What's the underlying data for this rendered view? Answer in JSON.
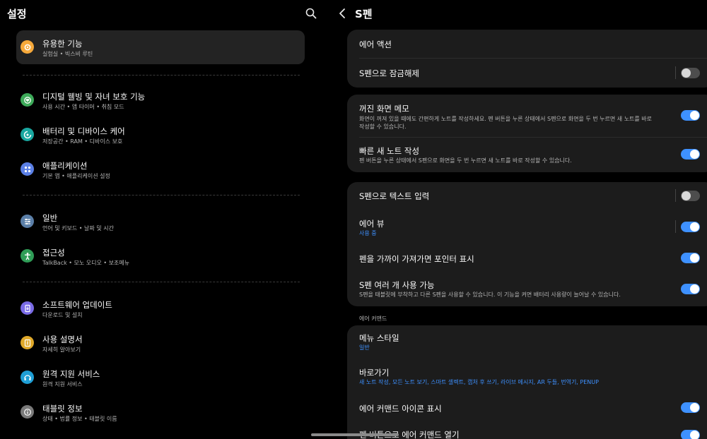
{
  "left": {
    "title": "설정",
    "items": [
      {
        "title": "유용한 기능",
        "subtitle": "실험실 • 빅스비 루틴",
        "icon": "gear-star-icon",
        "color": "#f6a93b"
      },
      {
        "title": "디지털 웰빙 및 자녀 보호 기능",
        "subtitle": "사용 시간 • 앱 타이머 • 취침 모드",
        "icon": "heart-icon",
        "color": "#3daa59"
      },
      {
        "title": "배터리 및 디바이스 케어",
        "subtitle": "저장공간 • RAM • 디바이스 보호",
        "icon": "device-care-icon",
        "color": "#19a7a0"
      },
      {
        "title": "애플리케이션",
        "subtitle": "기본 앱 • 애플리케이션 설정",
        "icon": "apps-icon",
        "color": "#5b80e6"
      },
      {
        "title": "일반",
        "subtitle": "언어 및 키보드 • 날짜 및 시간",
        "icon": "sliders-icon",
        "color": "#5b7fa8"
      },
      {
        "title": "접근성",
        "subtitle": "TalkBack • 모노 오디오 • 보조메뉴",
        "icon": "accessibility-icon",
        "color": "#2f9d57"
      },
      {
        "title": "소프트웨어 업데이트",
        "subtitle": "다운로드 및 설치",
        "icon": "update-icon",
        "color": "#7a6be6"
      },
      {
        "title": "사용 설명서",
        "subtitle": "자세히 알아보기",
        "icon": "manual-icon",
        "color": "#e0a92a"
      },
      {
        "title": "원격 지원 서비스",
        "subtitle": "원격 지원 서비스",
        "icon": "headset-icon",
        "color": "#1f9fd6"
      },
      {
        "title": "태블릿 정보",
        "subtitle": "상태 • 법률 정보 • 태블릿 이름",
        "icon": "info-icon",
        "color": "#7a7a7a"
      }
    ]
  },
  "right": {
    "title": "S펜",
    "rows": [
      {
        "title": "에어 액션"
      },
      {
        "title": "S펜으로 잠금해제",
        "toggle": false
      },
      {
        "title": "꺼진 화면 메모",
        "subtitle": "화면이 꺼져 있을 때에도 간편하게 노트를 작성하세요. 펜 버튼을 누른 상태에서 S펜으로 화면을 두 번 누르면 새 노트를 바로 작성할 수 있습니다.",
        "toggle": true
      },
      {
        "title": "빠른 새 노트 작성",
        "subtitle": "펜 버튼을 누른 상태에서 S펜으로 화면을 두 번 누르면 새 노트를 바로 작성할 수 있습니다.",
        "toggle": true
      },
      {
        "title": "S펜으로 텍스트 입력",
        "toggle": false
      },
      {
        "title": "에어 뷰",
        "subtitle": "사용 중",
        "toggle": true
      },
      {
        "title": "펜을 가까이 가져가면 포인터 표시",
        "toggle": true
      },
      {
        "title": "S펜 여러 개 사용 가능",
        "subtitle": "S펜을 태블릿에 부착하고 다른 S펜을 사용할 수 있습니다. 이 기능을 켜면 배터리 사용량이 늘어날 수 있습니다.",
        "toggle": true
      },
      {
        "title": "메뉴 스타일",
        "subtitle": "일반"
      },
      {
        "title": "바로가기",
        "subtitle": "새 노트 작성, 모든 노트 보기, 스마트 셀렉트, 캡처 후 쓰기, 라이브 메시지, AR 두들, 번역기, PENUP"
      },
      {
        "title": "에어 커맨드 아이콘 표시",
        "toggle": true
      },
      {
        "title": "펜 버튼으로 에어 커맨드 열기",
        "toggle": true
      }
    ],
    "section_label": "에어 커맨드"
  },
  "colors": {
    "accent": "#3e91ff",
    "card": "#1c1c1c",
    "active": "#232323"
  }
}
